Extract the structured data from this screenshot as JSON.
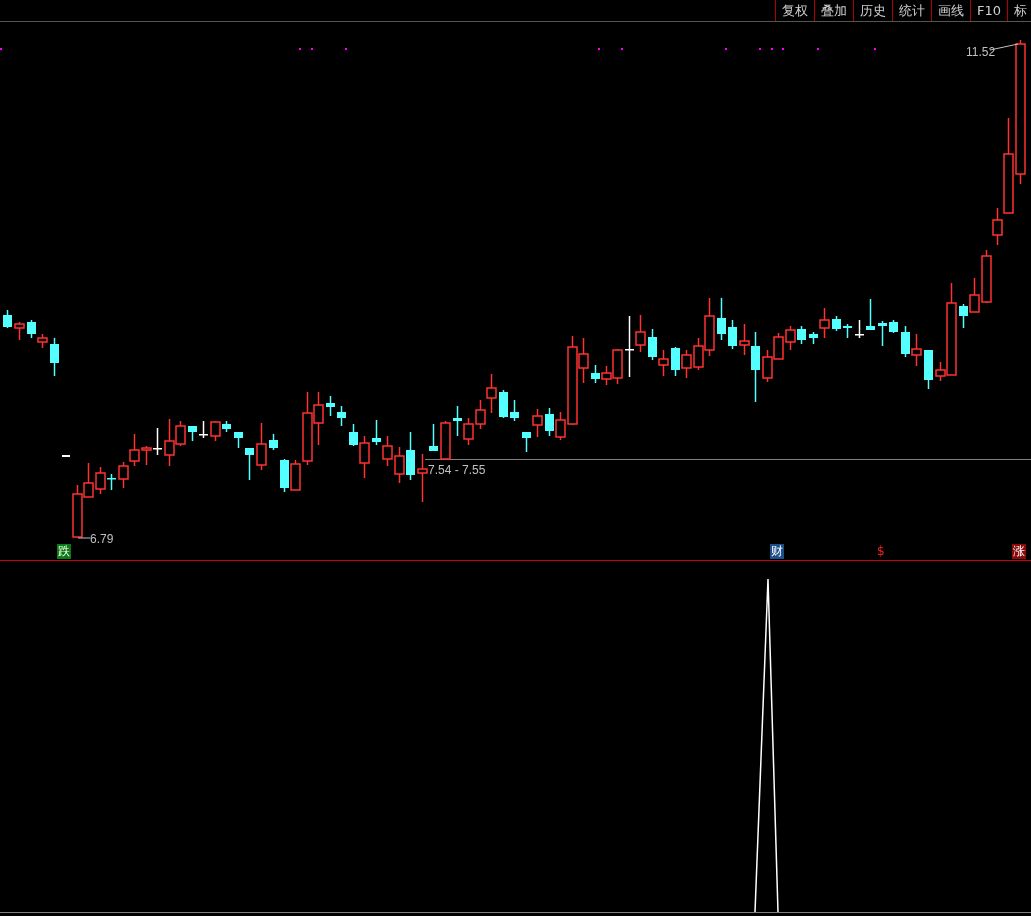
{
  "toolbar": {
    "buttons": [
      {
        "label": "复权"
      },
      {
        "label": "叠加"
      },
      {
        "label": "历史"
      },
      {
        "label": "统计"
      },
      {
        "label": "画线"
      },
      {
        "label": "F10"
      },
      {
        "label": "标"
      }
    ]
  },
  "price_chart": {
    "high_label": "11.52",
    "low_label": "6.79",
    "range_label": "7.54 - 7.55",
    "markers": [
      {
        "text": "跌",
        "kind": "down"
      },
      {
        "text": "财",
        "kind": "finance"
      },
      {
        "text": "$",
        "kind": "dollar"
      },
      {
        "text": "涨",
        "kind": "up"
      }
    ]
  }
}
